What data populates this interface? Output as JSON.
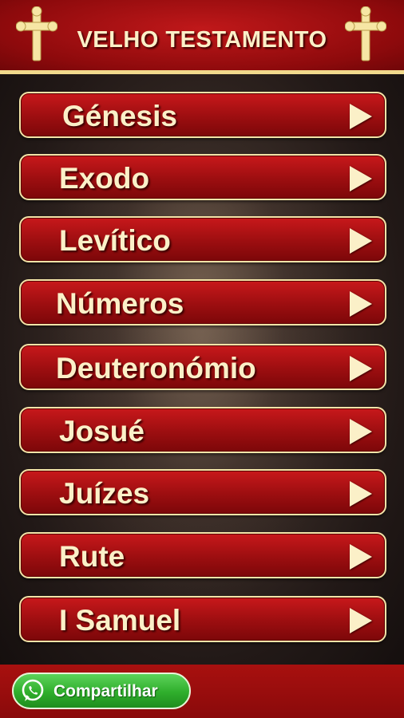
{
  "header": {
    "title": "VELHO TESTAMENTO",
    "left_icon": "cross-icon",
    "right_icon": "cross-icon"
  },
  "books": [
    {
      "label": "Génesis"
    },
    {
      "label": "Exodo"
    },
    {
      "label": "Levítico"
    },
    {
      "label": "Números"
    },
    {
      "label": "Deuteronómio"
    },
    {
      "label": "Josué"
    },
    {
      "label": "Juízes"
    },
    {
      "label": "Rute"
    },
    {
      "label": "I Samuel"
    }
  ],
  "footer": {
    "share_label": "Compartilhar",
    "share_icon": "whatsapp-icon"
  },
  "colors": {
    "primary_red": "#9c0e10",
    "cream": "#fbf0c8",
    "gold_border": "#f4e4a8",
    "share_green": "#2fae2c"
  }
}
